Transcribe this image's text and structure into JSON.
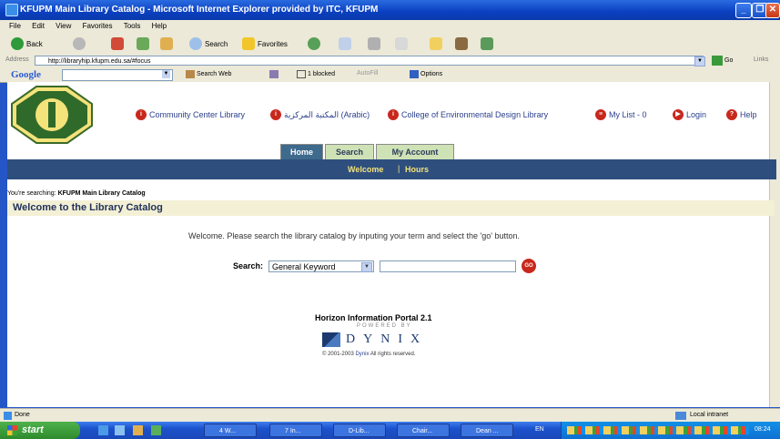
{
  "window": {
    "title": "KFUPM Main Library Catalog - Microsoft Internet Explorer provided by ITC, KFUPM"
  },
  "menu": [
    "File",
    "Edit",
    "View",
    "Favorites",
    "Tools",
    "Help"
  ],
  "toolbar": {
    "back": "Back",
    "search": "Search",
    "favorites": "Favorites"
  },
  "address": {
    "label": "Address",
    "url": "http://libraryhip.kfupm.edu.sa/#focus",
    "go": "Go",
    "links": "Links"
  },
  "google": {
    "brand": "Google",
    "search_web": "Search Web",
    "blocked": "1 blocked",
    "autofill": "AutoFill",
    "options": "Options"
  },
  "top_links": [
    "Community Center Library",
    "المكتبة المركزية (Arabic)",
    "College of Environmental Design Library",
    "My List - 0",
    "Login",
    "Help"
  ],
  "tabs": [
    "Home",
    "Search",
    "My Account"
  ],
  "subnav": {
    "welcome": "Welcome",
    "separator": "|",
    "hours": "Hours"
  },
  "searching": {
    "prefix": "You're searching:",
    "catalog": "KFUPM Main Library Catalog"
  },
  "welcome_heading": "Welcome to the Library Catalog",
  "welcome_message": "Welcome. Please search the library catalog by inputing your term and select the 'go' button.",
  "search": {
    "label": "Search:",
    "selected": "General Keyword",
    "go": "GO"
  },
  "footer": {
    "portal": "Horizon Information Portal 2.1",
    "powered": "POWERED BY",
    "brand": "DYNIX",
    "copyright_pre": "© 2001-2003",
    "copyright_brand": "Dynix",
    "copyright_post": "All rights reserved."
  },
  "status": {
    "left": "Done",
    "zone": "Local intranet"
  },
  "taskbar": {
    "start": "start",
    "tasks": [
      "4 W...",
      "7 In...",
      "D-Lib...",
      "Chair...",
      "Dean ..."
    ],
    "lang": "EN",
    "clock": "08:24"
  },
  "colors": {
    "accent_blue": "#2e4f7e",
    "tab_green": "#4a7a3a",
    "red_icon": "#c8281c"
  }
}
